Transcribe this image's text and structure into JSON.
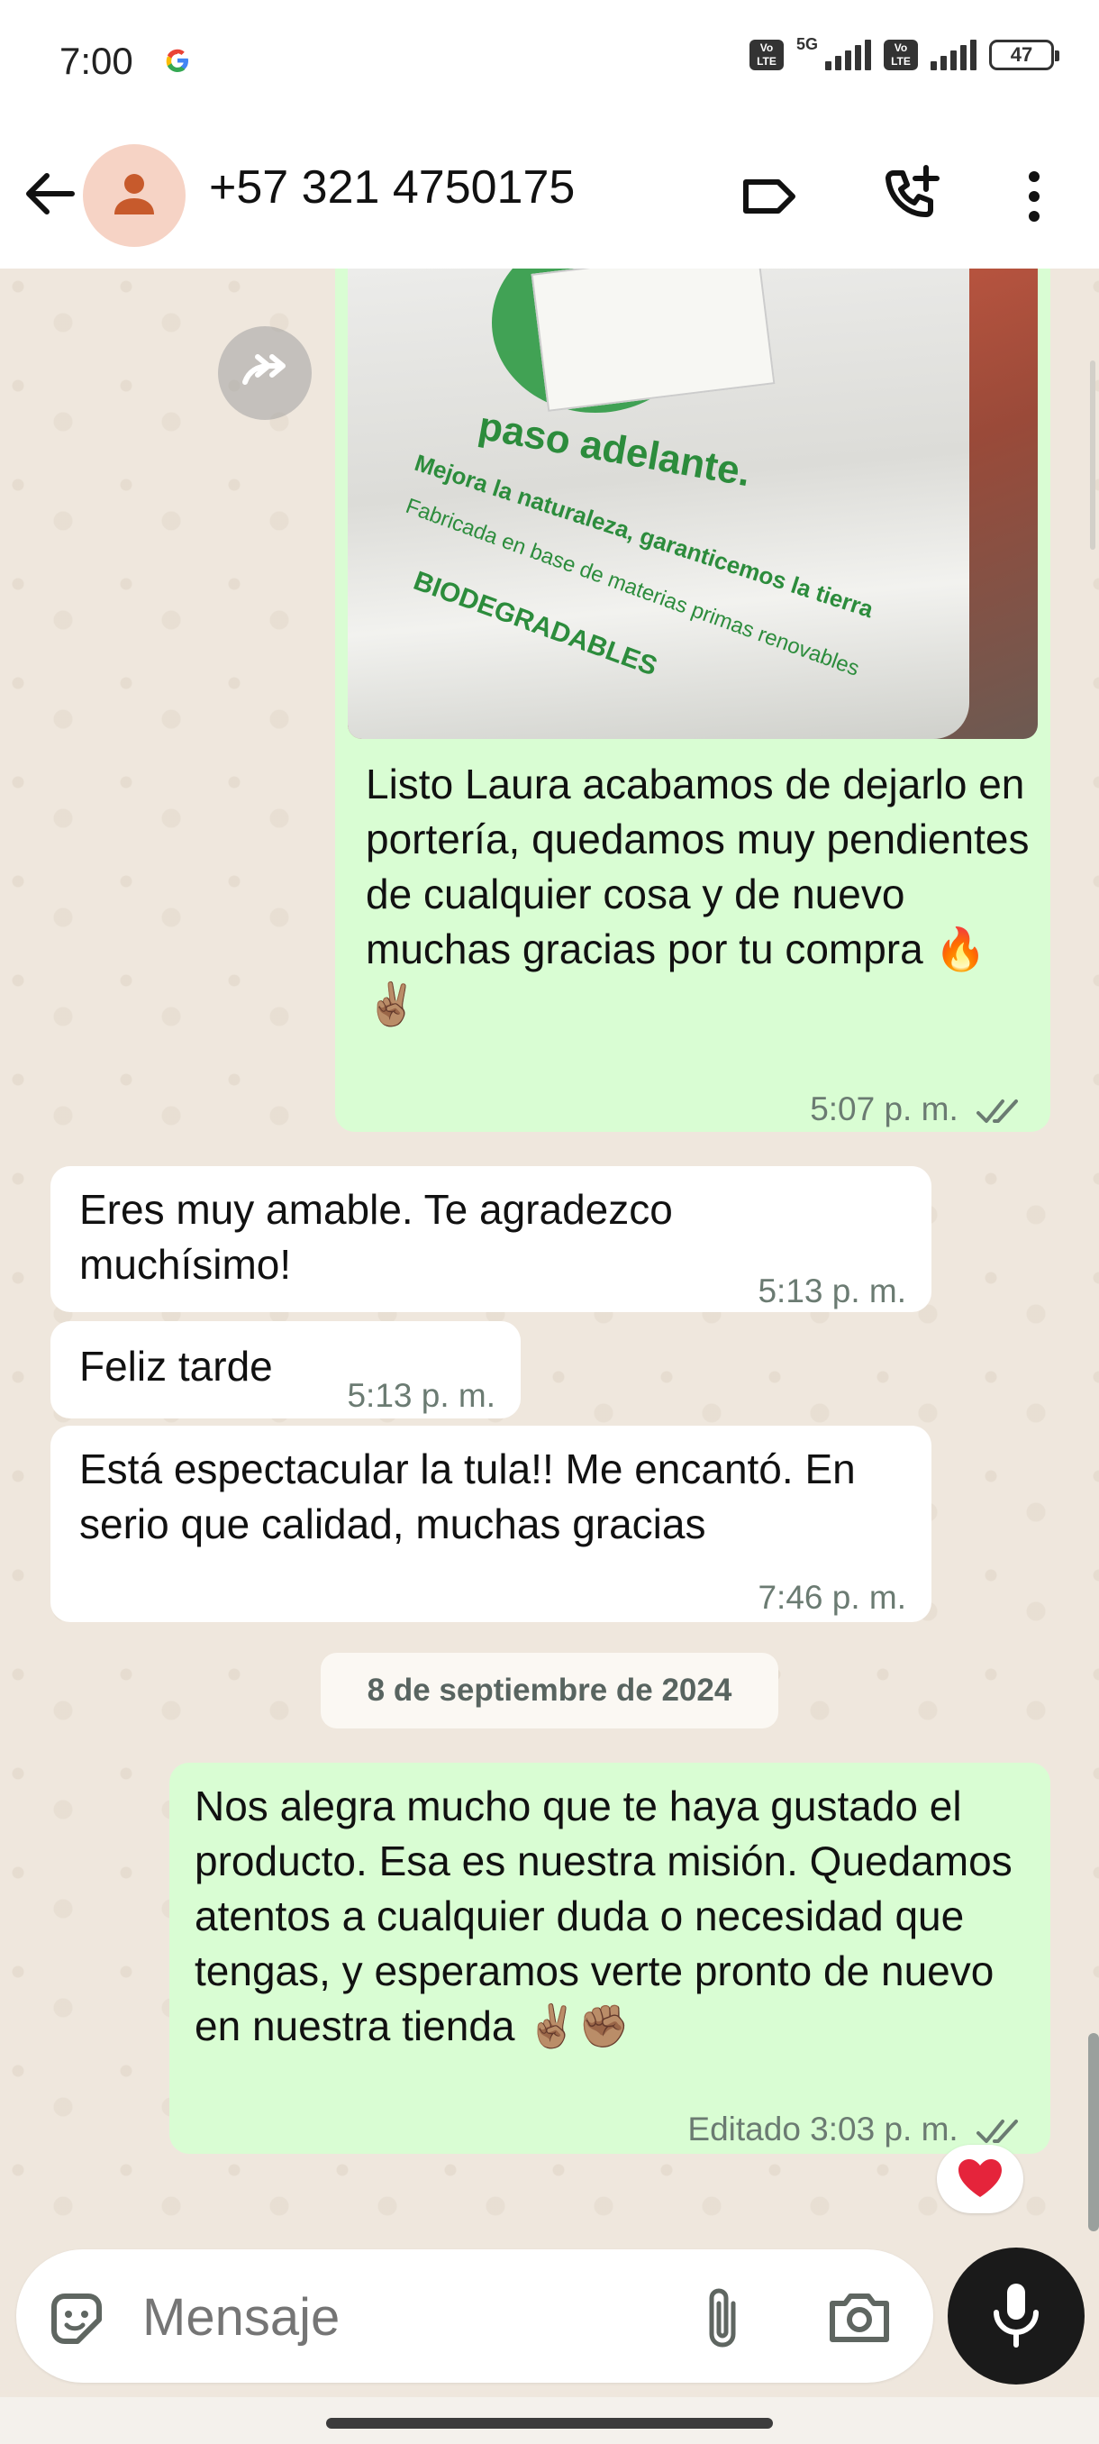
{
  "status_bar": {
    "time": "7:00",
    "network": "5G",
    "volte_label": "Vo LTE",
    "battery": "47"
  },
  "header": {
    "contact": "+57 321 4750175",
    "icons": [
      "back-arrow-icon",
      "person-icon",
      "label-icon",
      "add-call-icon",
      "more-vert-icon"
    ]
  },
  "messages": [
    {
      "direction": "out",
      "text": "Listo Laura acabamos de dejarlo en portería, quedamos muy pendientes de cualquier cosa y de nuevo muchas gracias por tu compra 🔥✌🏽",
      "time": "5:07 p. m.",
      "status": "read"
    },
    {
      "direction": "in",
      "text": "Eres muy amable. Te agradezco muchísimo!",
      "time": "5:13 p. m."
    },
    {
      "direction": "in",
      "text": "Feliz tarde",
      "time": "5:13 p. m."
    },
    {
      "direction": "in",
      "text": "Está espectacular la tula!! Me encantó. En serio que calidad, muchas gracias",
      "time": "7:46 p. m."
    },
    {
      "direction": "out",
      "text": "Nos alegra mucho que te haya gustado el producto. Esa es nuestra misión. Quedamos atentos a cualquier duda o necesidad que tengas, y esperamos verte pronto de nuevo en nuestra tienda ✌🏽✊🏽",
      "time": "Editado 3:03 p. m.",
      "status": "read",
      "reaction": "❤️"
    }
  ],
  "date_separator": "8 de septiembre de 2024",
  "input": {
    "placeholder": "Mensaje",
    "icons": [
      "sticker-icon",
      "attach-icon",
      "camera-icon",
      "mic-icon"
    ]
  }
}
